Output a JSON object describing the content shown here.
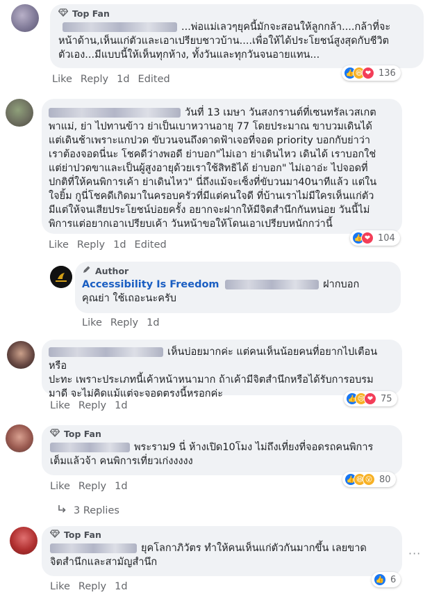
{
  "badges": {
    "top_fan": "Top Fan",
    "author": "Author"
  },
  "actions": {
    "like": "Like",
    "reply": "Reply",
    "edited": "Edited"
  },
  "comments": [
    {
      "text_lines": [
        "...พ่อแม่เลวๆยุคนี้มักจะสอนให้ลูกกล้า....กล้าที่จะ",
        "หน้าด้าน,เห็นแก่ตัวและเอาเปรียบชาวบ้าน....เพื่อให้ได้ประโยชน์สูงสุดกับชีวิต",
        "ตัวเอง...มีแบบนี้ให้เห็นทุกห้าง, ทั้งวันและทุกวันจนอายแทน..."
      ],
      "time": "1d",
      "reactions_count": "136"
    },
    {
      "text_lines": [
        "วันที่ 13 เมษา วันสงกรานต์ที่เซนทรัลเวสเกต",
        "พาแม่, ย่า ไปทานข้าว ย่าเป็นเบาหวานอายุ 77 โดยประมาณ ขาบวมเดินได้",
        "แต่เดินช้าเพราะแกปวด ขับวนจนถึงดาดฟ้าเจอที่จอด priority บอกกับย่าว่า",
        "เราต้องจอดนี่นะ โชคดีว่างพอดี ย่าบอก\"ไม่เอา ย่าเดินไหว เดินได้ เราบอกใช่",
        "แต่ย่าปวดขาและเป็นผู้สูงอายุด้วยเราใช้สิทธิได้ ย่าบอก\" ไม่เอาอ่ะ ไปจอดที่",
        "ปกติที่ให้คนพิการเค้า ย่าเดินไหว\" นี่ถึงแม้จะเซ็งที่ขับวนมา40นาทีแล้ว แต่ใน",
        "ใจยิ้ม กูนี่โชคดีเกิดมาในครอบครัวที่มีแต่คนใจดี ที่บ้านเราไม่มีใครเห็นแก่ตัว",
        "มีแต่ให้จนเสียประโยชน์บ่อยครั้ง อยากจะฝากให้มีจิตสำนึกกันหน่อย วันนี้ไม่",
        "พิการแต่อยากเอาเปรียบเค้า วันหน้าขอให้โดนเอาเปรียบหนักกว่านี้"
      ],
      "time": "1d",
      "reactions_count": "104"
    },
    {
      "author_name": "Accessibility Is Freedom",
      "text_lines": [
        "ฝากบอก",
        "คุณย่า ใช้เถอะนะครับ"
      ],
      "time": "1d"
    },
    {
      "text_lines": [
        "เห็นบ่อยมากค่ะ แต่คนเห็นน้อยคนที่อยากไปเตือนหรือ",
        "ปะทะ เพราะประเภทนี้เค้าหน้าหนามาก ถ้าเค้ามีจิตสำนึกหรือได้รับการอบรม",
        "มาดี จะไม่คิดแม้แต่จะจอดตรงนี้หรอกค่ะ"
      ],
      "time": "1d",
      "reactions_count": "75"
    },
    {
      "text_lines": [
        "พระราม9 นี่ ห้างเปิด10โมง ไม่ถึงเที่ยงที่จอดรถคนพิการ",
        "เต็มแล้วจ้า คนพิการเที่ยวเก่งงงงง"
      ],
      "time": "1d",
      "reactions_count": "80",
      "replies_label": "3 Replies"
    },
    {
      "text_lines": [
        "ยุคโลกาภิวัตร ทำให้คนเห็นแก่ตัวกันมากขึ้น เลยขาด",
        "จิตสำนึกและสามัญสำนึก"
      ],
      "time": "1d",
      "reactions_count": "6"
    }
  ],
  "colors": {
    "link": "#1a5ec2",
    "like": "#1877f2",
    "love": "#f33e58",
    "bubble": "#f0f2f5"
  }
}
